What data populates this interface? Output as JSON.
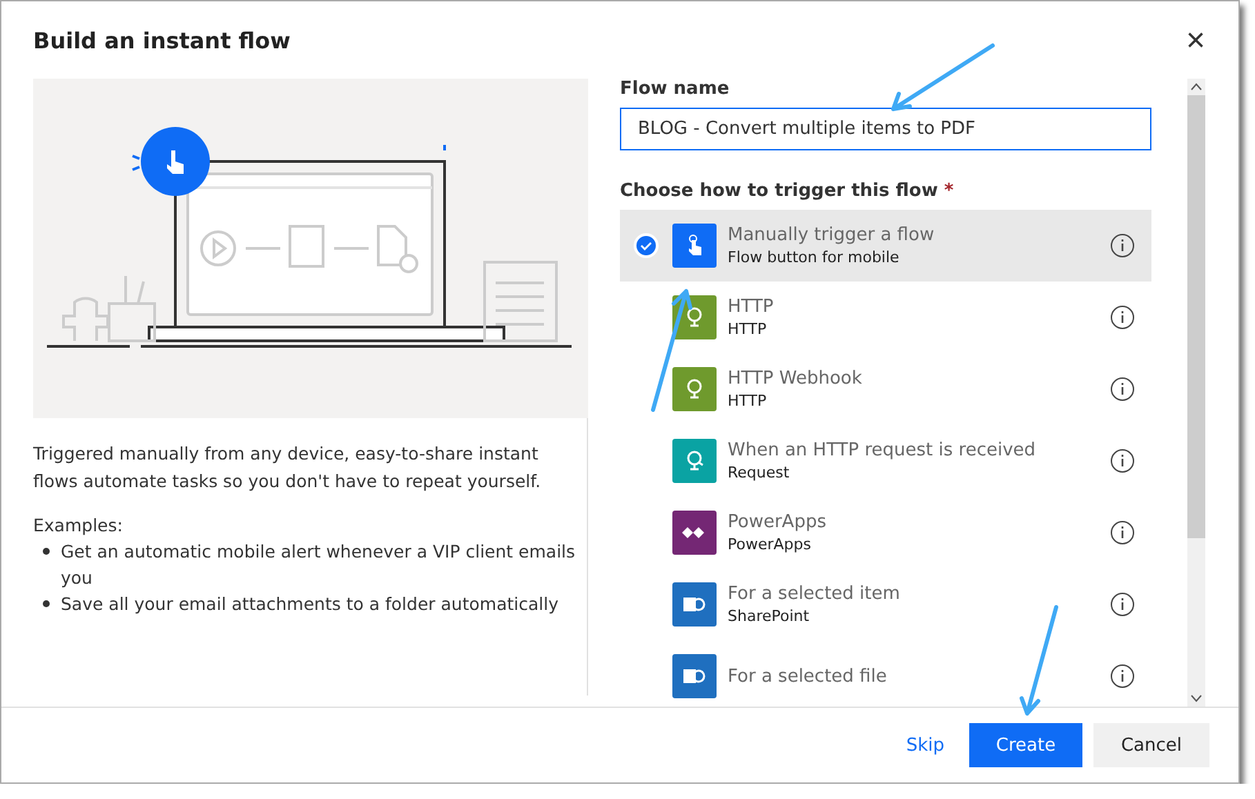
{
  "dialog": {
    "title": "Build an instant flow",
    "close": "×"
  },
  "description": "Triggered manually from any device, easy-to-share instant flows automate tasks so you don't have to repeat yourself.",
  "examples_label": "Examples:",
  "examples": [
    "Get an automatic mobile alert whenever a VIP client emails you",
    "Save all your email attachments to a folder automatically"
  ],
  "flow_name": {
    "label": "Flow name",
    "value": "BLOG - Convert multiple items to PDF"
  },
  "trigger": {
    "label": "Choose how to trigger this flow",
    "required_mark": "*"
  },
  "triggers": [
    {
      "title": "Manually trigger a flow",
      "subtitle": "Flow button for mobile",
      "kind": "manual",
      "color": "#0f6cf5",
      "selected": true
    },
    {
      "title": "HTTP",
      "subtitle": "HTTP",
      "kind": "http",
      "color": "#6f9a2d",
      "selected": false
    },
    {
      "title": "HTTP Webhook",
      "subtitle": "HTTP",
      "kind": "http",
      "color": "#6f9a2d",
      "selected": false
    },
    {
      "title": "When an HTTP request is received",
      "subtitle": "Request",
      "kind": "request",
      "color": "#0aa3a3",
      "selected": false
    },
    {
      "title": "PowerApps",
      "subtitle": "PowerApps",
      "kind": "powerapps",
      "color": "#742774",
      "selected": false
    },
    {
      "title": "For a selected item",
      "subtitle": "SharePoint",
      "kind": "sharepoint",
      "color": "#1f6fbf",
      "selected": false
    },
    {
      "title": "For a selected file",
      "kind": "sharepoint",
      "color": "#1f6fbf",
      "selected": false
    }
  ],
  "buttons": [
    {
      "label": "Skip",
      "kind": "link"
    },
    {
      "label": "Create",
      "kind": "primary"
    },
    {
      "label": "Cancel",
      "kind": "secondary"
    }
  ]
}
